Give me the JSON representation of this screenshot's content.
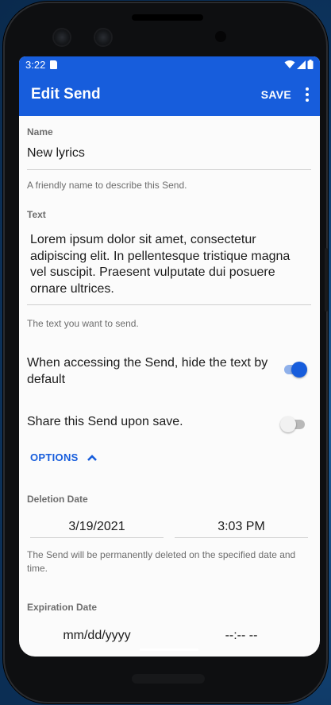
{
  "status_bar": {
    "time": "3:22"
  },
  "app_bar": {
    "title": "Edit Send",
    "save_label": "SAVE"
  },
  "name_section": {
    "label": "Name",
    "value": "New lyrics",
    "helper": "A friendly name to describe this Send."
  },
  "text_section": {
    "label": "Text",
    "value": "Lorem ipsum dolor sit amet, consectetur adipiscing elit. In pellentesque tristique magna vel suscipit. Praesent vulputate dui posuere ornare ultrices.",
    "helper": "The text you want to send."
  },
  "toggles": [
    {
      "label": "When accessing the Send, hide the text by default",
      "on": true
    },
    {
      "label": "Share this Send upon save.",
      "on": false
    }
  ],
  "options": {
    "label": "OPTIONS",
    "icon": "chevron-up-icon",
    "expanded": true
  },
  "deletion": {
    "label": "Deletion Date",
    "date": "3/19/2021",
    "time": "3:03 PM",
    "helper": "The Send will be permanently deleted on the specified date and time."
  },
  "expiration": {
    "label": "Expiration Date",
    "date_placeholder": "mm/dd/yyyy",
    "time_placeholder": "--:-- --"
  },
  "colors": {
    "accent": "#175DDC",
    "background": "#FBFBFB"
  }
}
